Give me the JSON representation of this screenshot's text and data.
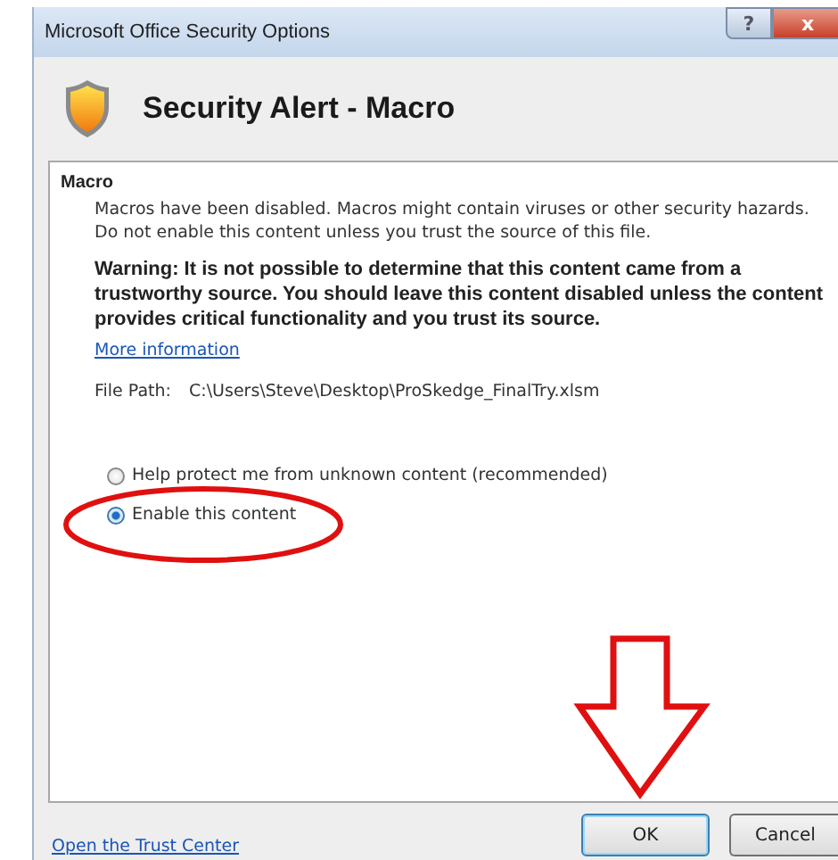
{
  "window": {
    "title": "Microsoft Office Security Options",
    "controls": [
      {
        "kind": "help",
        "label": "?"
      },
      {
        "kind": "close",
        "label": "x"
      }
    ]
  },
  "header": {
    "title": "Security Alert - Macro"
  },
  "section": {
    "title": "Macro",
    "description": "Macros have been disabled. Macros might contain viruses or other security hazards. Do not enable this content unless you trust the source of this file.",
    "warning": "**Warning:** It is not possible to determine that this content came from a trustworthy source. You should leave this content disabled unless the content provides critical functionality and you trust its source.",
    "link": "More information",
    "file_path_label": "File Path:",
    "file_path": "C:\\Users\\Steve\\Desktop\\ProSkedge_FinalTry.xlsm",
    "options": [
      {
        "label": "Help protect me from unknown content (recommended)",
        "selected": false
      },
      {
        "label": "Enable this content",
        "selected": true
      }
    ]
  },
  "footer": {
    "link": "Open the Trust Center",
    "buttons": [
      {
        "label": "OK",
        "default": true
      },
      {
        "label": "Cancel",
        "default": false
      }
    ]
  },
  "annotations": [
    {
      "kind": "ellipse"
    },
    {
      "kind": "arrow"
    }
  ]
}
